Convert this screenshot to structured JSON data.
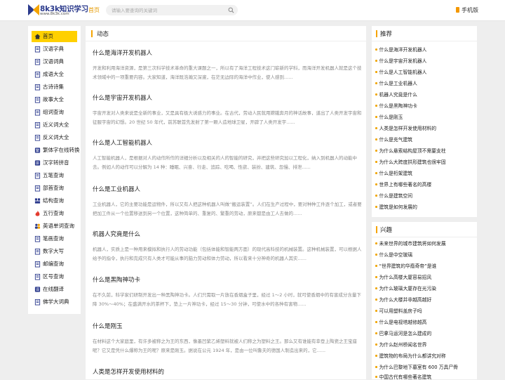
{
  "header": {
    "logo_title": "8k3k知识学习",
    "logo_sub": "www.8k3k.com",
    "nav_home": "首页",
    "search_placeholder": "请输入要查询的关键词",
    "mobile_label": "手机版"
  },
  "sidebar": {
    "items": [
      {
        "label": "首页",
        "icon": "home-icon"
      },
      {
        "label": "汉语字典",
        "icon": "book-icon"
      },
      {
        "label": "汉语词典",
        "icon": "book-icon"
      },
      {
        "label": "成语大全",
        "icon": "book-icon"
      },
      {
        "label": "古诗诗集",
        "icon": "book-icon"
      },
      {
        "label": "故事大全",
        "icon": "book-icon"
      },
      {
        "label": "组词查询",
        "icon": "book-icon"
      },
      {
        "label": "近义词大全",
        "icon": "book-icon"
      },
      {
        "label": "反义词大全",
        "icon": "book-icon"
      },
      {
        "label": "繁体字在线转换",
        "icon": "convert-icon"
      },
      {
        "label": "汉字转拼音",
        "icon": "pinyin-icon"
      },
      {
        "label": "五笔查询",
        "icon": "book-icon"
      },
      {
        "label": "部首查询",
        "icon": "book-icon"
      },
      {
        "label": "结构查询",
        "icon": "structure-icon"
      },
      {
        "label": "五行查询",
        "icon": "fire-icon"
      },
      {
        "label": "英语单词查询",
        "icon": "people-icon"
      },
      {
        "label": "笔画查询",
        "icon": "book-icon"
      },
      {
        "label": "数字大写",
        "icon": "book-icon"
      },
      {
        "label": "邮编查询",
        "icon": "book-icon"
      },
      {
        "label": "区号查询",
        "icon": "book-icon"
      },
      {
        "label": "在线翻译",
        "icon": "translate-icon"
      },
      {
        "label": "佛学大词典",
        "icon": "book-icon"
      }
    ]
  },
  "main": {
    "heading": "动态",
    "articles": [
      {
        "title": "什么是海洋开发机器人",
        "text": "开发和利用海洋资源，是第三次科学技术革命的重大课题之一，所以有了海洋工程技术这门崭新的学科，而海洋开发机器人就是这个技术领域中的一项重要内容。大家知道，海洋既浩瀚又深邃，在茫无边际的海洋中作业，使人感到......"
      },
      {
        "title": "什么是宇宙开发机器人",
        "text": "宇宙开发对人类来说是全新的事业，又是具有极大诱惑力的事业。在古代，劳动人民就用嫦娥奔月的神话故事，道出了人类开发宇宙和征服宇宙的幻想。20 世纪 50 年代，前苏联首先发射了第一颗人造地球卫星，开辟了人类开发宇......"
      },
      {
        "title": "什么是人工智能机器人",
        "text": "人工智能机器人，是根据对人的动作所作的详细分析以及相关的人的智能的研究，并把这些研究加以工程化，纳入到机器人的动能中去。例如人的动作可以分解为 14 种：睡眠、兴奋、行走、追踪、吃喝、性欲、装扮、建筑、忽慢、排泄......"
      },
      {
        "title": "什么是工业机器人",
        "text": "工业机器人，它的主要功能是运物件，所以又有人把这种机器人叫做“搬运装置”。人们在生产过程中，要对种种工件逐个加工，或者要把加工件从一个位置移送到另一个位置，这种简单的、重复的、繁重的劳动，原来都是由工人去做的......"
      },
      {
        "title": "机器人究竟是什么",
        "text": "机器人，实质上是一种用来模拟和执行人的劳动功能（包括体能和智能两方面）的现代高科技的机械装置。这种机械装置，可以根据人给予的指令，执行和完成只有人类才可能从事的脑力劳动和体力劳动，所以看来十分神奇的机器人其实......"
      },
      {
        "title": "什么是黑陶神功卡",
        "text": "在不久前，科学家们研制开发出一种黑陶神功卡。人们只需取一片放在香烟盒子里，经过 1～2 小时，就可使香烟中的有害成分含量下降 30%～40%；在盛满开水的茶杯下，垫上一片神功卡，经过 15～30 分钟，可使水中的各种有害物......"
      },
      {
        "title": "什么是刚玉",
        "text": "在材料这个大家庭里，有许多被称之为王的东西，像墨凹紫乙烯塑料就被人们称之为塑料之王。那么又有谁能有幸登上陶瓷之王宝座呢？它又是凭什么爆称为王的呢？原来是刚玉。据说在公元 1924 年，是由一位叫鲁夫的德国人制造出来的，它......"
      },
      {
        "title": "人类是怎样开发使用材料的",
        "text": ""
      }
    ]
  },
  "recommend": {
    "title": "推荐",
    "links": [
      "什么是海洋开发机器人",
      "什么是宇宙开发机器人",
      "什么是人工智能机器人",
      "什么是工业机器人",
      "机器人究竟是什么",
      "什么是黑陶神功卡",
      "什么是刚玉",
      "人类是怎样开发使用材料的",
      "什么是充气建筑",
      "为什么悬索结构屋顶不需要支柱",
      "为什么大跨度拱形建筑也很牢固",
      "什么是桁架建筑",
      "世界上有哪些著名的高楼",
      "什么是建筑空间",
      "建筑是如何发展的"
    ]
  },
  "interest": {
    "title": "兴趣",
    "links": [
      "未来世界的城市建筑将如何发展",
      "什么是中空玻璃",
      "“世界建筑的华裔奇帝”是谁",
      "为什么高楼大厦容易招风",
      "为什么玻璃大厦存在光污染",
      "为什么大楼并非越高越好",
      "可以用塑料盖房子吗",
      "什么是电视塔越修越高",
      "巴拿马运河是怎么建成的",
      "为什么赵州桥闻名世界",
      "建筑物的布局为什么都讲究对称",
      "为什么巴黎地下墓室有 600 万具尸骨",
      "中国古代有哪些著名建筑"
    ]
  },
  "colors": {
    "accent": "#f5a400",
    "active_item": "#ffd000",
    "brand": "#2b3a8c"
  }
}
